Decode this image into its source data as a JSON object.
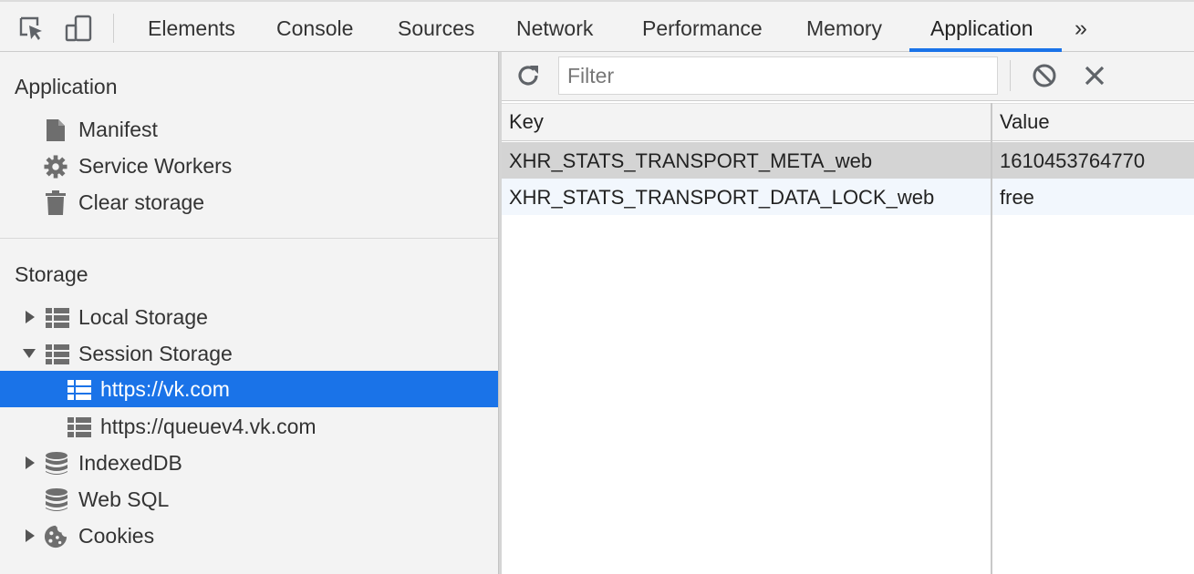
{
  "toolbar": {
    "inspect_icon": "inspect-element-icon",
    "device_icon": "device-toolbar-icon",
    "tabs": [
      {
        "label": "Elements"
      },
      {
        "label": "Console"
      },
      {
        "label": "Sources"
      },
      {
        "label": "Network"
      },
      {
        "label": "Performance"
      },
      {
        "label": "Memory"
      },
      {
        "label": "Application",
        "active": true
      }
    ],
    "more_tabs": "»"
  },
  "sidebar": {
    "application": {
      "title": "Application",
      "items": [
        {
          "label": "Manifest",
          "icon": "document-icon"
        },
        {
          "label": "Service Workers",
          "icon": "gear-icon"
        },
        {
          "label": "Clear storage",
          "icon": "trash-icon"
        }
      ]
    },
    "storage": {
      "title": "Storage",
      "items": [
        {
          "label": "Local Storage",
          "icon": "table-icon",
          "expanded": false
        },
        {
          "label": "Session Storage",
          "icon": "table-icon",
          "expanded": true
        },
        {
          "label": "https://vk.com",
          "icon": "table-icon",
          "selected": true
        },
        {
          "label": "https://queuev4.vk.com",
          "icon": "table-icon"
        },
        {
          "label": "IndexedDB",
          "icon": "database-icon",
          "expanded": false
        },
        {
          "label": "Web SQL",
          "icon": "database-icon"
        },
        {
          "label": "Cookies",
          "icon": "cookie-icon",
          "expanded": false
        }
      ]
    }
  },
  "filter_bar": {
    "refresh_icon": "refresh-icon",
    "placeholder": "Filter",
    "value": "",
    "clear_all_icon": "block-icon",
    "delete_icon": "close-icon"
  },
  "grid": {
    "columns": [
      "Key",
      "Value"
    ],
    "rows": [
      {
        "key": "XHR_STATS_TRANSPORT_META_web",
        "value": "1610453764770",
        "selected": true
      },
      {
        "key": "XHR_STATS_TRANSPORT_DATA_LOCK_web",
        "value": "free"
      }
    ]
  },
  "colors": {
    "accent": "#1a73e8",
    "panel_bg": "#f3f3f3",
    "selected_row": "#d4d4d4"
  }
}
